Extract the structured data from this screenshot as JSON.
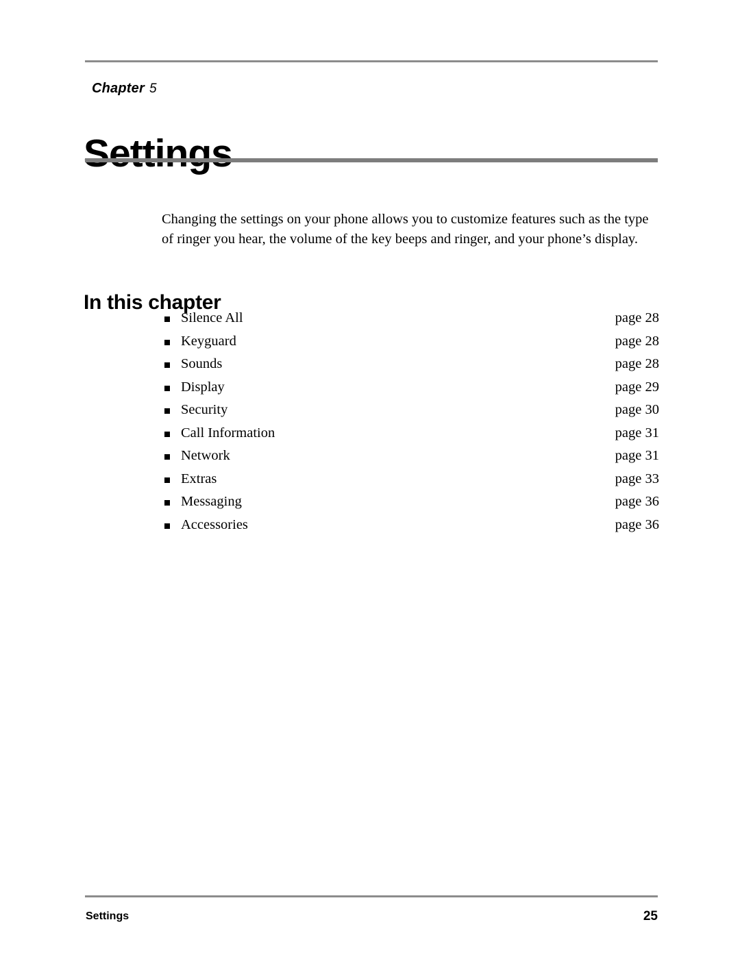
{
  "chapter": {
    "label": "Chapter",
    "number": "5",
    "title": "Settings"
  },
  "intro": {
    "text": "Changing the settings on your phone allows you to customize features such as the type of ringer you hear, the volume of the key beeps and ringer, and your phone’s display."
  },
  "section": {
    "heading": "In this chapter"
  },
  "contents": [
    {
      "label": "Silence All",
      "page": "page 28"
    },
    {
      "label": "Keyguard",
      "page": "page 28"
    },
    {
      "label": "Sounds",
      "page": "page 28"
    },
    {
      "label": "Display",
      "page": "page 29"
    },
    {
      "label": "Security",
      "page": "page 30"
    },
    {
      "label": "Call Information",
      "page": "page 31"
    },
    {
      "label": "Network",
      "page": "page 31"
    },
    {
      "label": "Extras",
      "page": "page 33"
    },
    {
      "label": "Messaging",
      "page": "page 36"
    },
    {
      "label": "Accessories",
      "page": "page 36"
    }
  ],
  "footer": {
    "left": "Settings",
    "page_number": "25"
  }
}
